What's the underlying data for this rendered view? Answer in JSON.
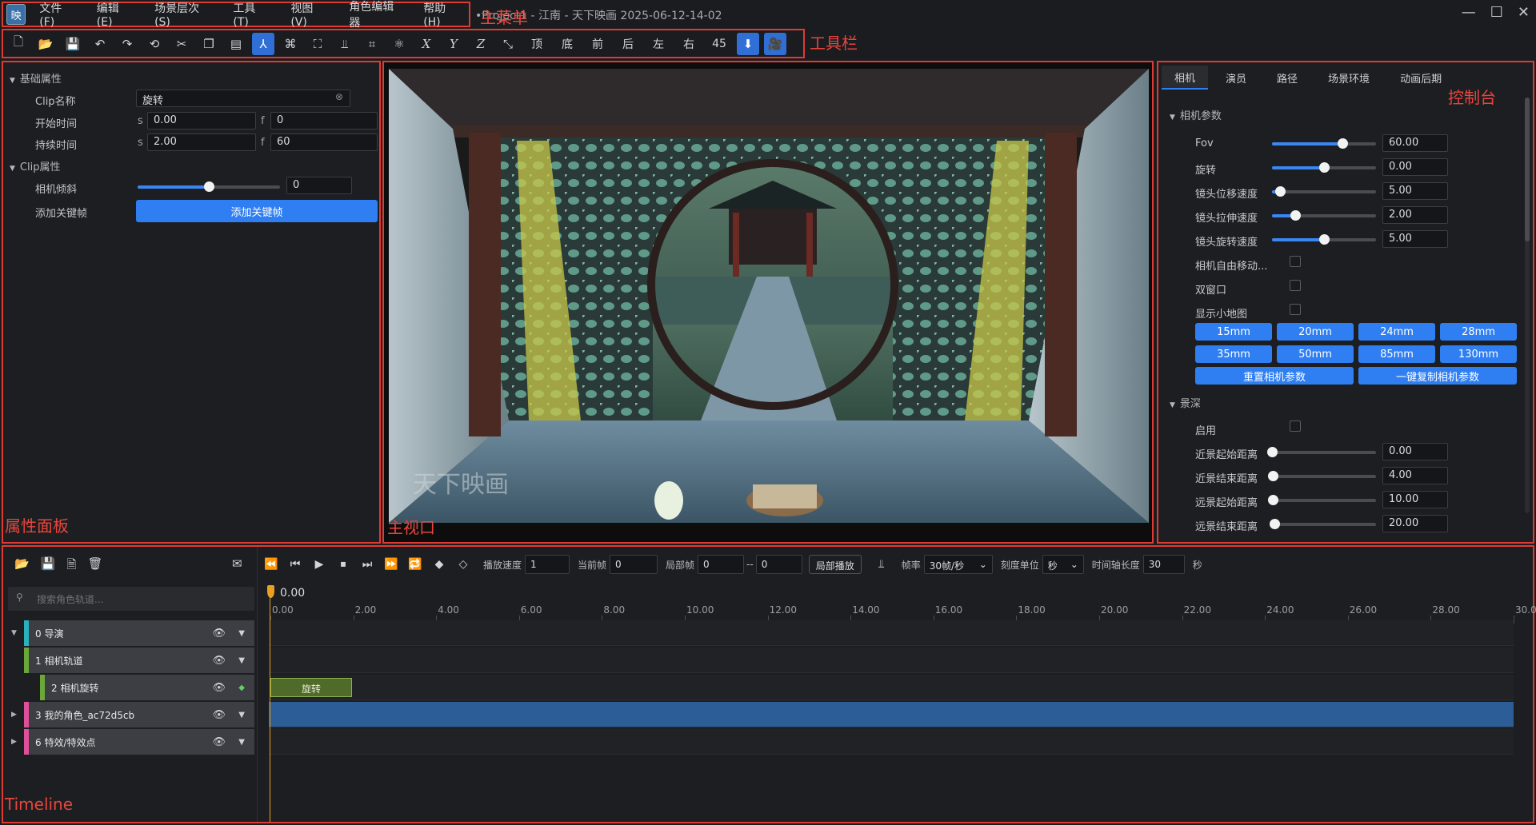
{
  "app": {
    "logo_glyph": "映",
    "title": "•Project1 - 江南 - 天下映画 2025-06-12-14-02"
  },
  "annotations": {
    "menu": "主菜单",
    "toolbar": "工具栏",
    "properties": "属性面板",
    "viewport": "主视口",
    "console": "控制台",
    "timeline": "Timeline"
  },
  "menu": [
    "文件(F)",
    "编辑(E)",
    "场景层次(S)",
    "工具(T)",
    "视图(V)",
    "角色编辑器",
    "帮助(H)"
  ],
  "window_controls": {
    "minimize": "—",
    "maximize": "☐",
    "close": "✕"
  },
  "toolbar": {
    "icons": [
      {
        "name": "new-file-icon",
        "glyph": "🗋"
      },
      {
        "name": "open-folder-icon",
        "glyph": "📂"
      },
      {
        "name": "save-icon",
        "glyph": "💾"
      },
      {
        "name": "undo-icon",
        "glyph": "↶"
      },
      {
        "name": "redo-icon",
        "glyph": "↷"
      },
      {
        "name": "history-icon",
        "glyph": "⟲"
      },
      {
        "name": "cut-icon",
        "glyph": "✂"
      },
      {
        "name": "copy-icon",
        "glyph": "❐"
      },
      {
        "name": "paste-icon",
        "glyph": "▤"
      },
      {
        "name": "transform-gizmo-icon",
        "glyph": "⅄"
      },
      {
        "name": "group-icon",
        "glyph": "⌘"
      },
      {
        "name": "fullscreen-icon",
        "glyph": "⛶"
      },
      {
        "name": "align-icon",
        "glyph": "⫫"
      },
      {
        "name": "crop-icon",
        "glyph": "⌗"
      },
      {
        "name": "nodes-icon",
        "glyph": "⚛"
      }
    ],
    "axes": [
      "X",
      "Y",
      "Z"
    ],
    "axis_icon": "⤡",
    "views": [
      "顶",
      "底",
      "前",
      "后",
      "左",
      "右",
      "45"
    ],
    "camera_icons": [
      {
        "name": "download-icon",
        "glyph": "⬇"
      },
      {
        "name": "camera-icon",
        "glyph": "🎥"
      }
    ]
  },
  "properties": {
    "basic_section": "基础属性",
    "clip_name_label": "Clip名称",
    "clip_name_value": "旋转",
    "clip_name_clear": "⊗",
    "start_label": "开始时间",
    "start_s_unit": "s",
    "start_s": "0.00",
    "start_f_unit": "f",
    "start_f": "0",
    "duration_label": "持续时间",
    "duration_s_unit": "s",
    "duration_s": "2.00",
    "duration_f_unit": "f",
    "duration_f": "60",
    "clip_section": "Clip属性",
    "tilt_label": "相机倾斜",
    "tilt_value": "0",
    "tilt_fraction": 0.5,
    "keyframe_label": "添加关键帧",
    "keyframe_button": "添加关键帧"
  },
  "viewport": {
    "watermark": "天下映画"
  },
  "console": {
    "tabs": [
      "相机",
      "演员",
      "路径",
      "场景环境",
      "动画后期"
    ],
    "camera_section": "相机参数",
    "sliders": [
      {
        "label": "Fov",
        "value": "60.00",
        "fraction": 0.68
      },
      {
        "label": "旋转",
        "value": "0.00",
        "fraction": 0.5
      },
      {
        "label": "镜头位移速度",
        "value": "5.00",
        "fraction": 0.08
      },
      {
        "label": "镜头拉伸速度",
        "value": "2.00",
        "fraction": 0.22
      },
      {
        "label": "镜头旋转速度",
        "value": "5.00",
        "fraction": 0.5
      }
    ],
    "checks": [
      "相机自由移动...",
      "双窗口",
      "显示小地图"
    ],
    "lenses": [
      "15mm",
      "20mm",
      "24mm",
      "28mm",
      "35mm",
      "50mm",
      "85mm",
      "130mm"
    ],
    "reset_button": "重置相机参数",
    "copy_button": "一键复制相机参数",
    "dof_section": "景深",
    "dof_enable": "启用",
    "dof_sliders": [
      {
        "label": "近景起始距离",
        "value": "0.00",
        "fraction": 0.0
      },
      {
        "label": "近景结束距离",
        "value": "4.00",
        "fraction": 0.01
      },
      {
        "label": "远景起始距离",
        "value": "10.00",
        "fraction": 0.01
      },
      {
        "label": "远景结束距离",
        "value": "20.00",
        "fraction": 0.02
      }
    ]
  },
  "timeline": {
    "search_placeholder": "搜索角色轨道...",
    "tracks": [
      {
        "label": "0 导演",
        "color": "#2bb1bd"
      },
      {
        "label": "1 相机轨道",
        "color": "#6aa83a"
      },
      {
        "label": "2 相机旋转",
        "color": "#6aa83a"
      },
      {
        "label": "3 我的角色_ac72d5cb",
        "color": "#e04f9a"
      },
      {
        "label": "6 特效/特效点",
        "color": "#e04f9a"
      }
    ],
    "controls": {
      "speed_label": "播放速度",
      "speed_value": "1",
      "current_label": "当前帧",
      "current_value": "0",
      "local_label": "局部帧",
      "local_from": "0",
      "local_sep": "--",
      "local_to": "0",
      "local_play": "局部播放",
      "fps_label": "帧率",
      "fps_value": "30帧/秒",
      "unit_label": "刻度单位",
      "unit_value": "秒",
      "length_label": "时间轴长度",
      "length_value": "30",
      "length_unit": "秒"
    },
    "playhead": "0.00",
    "ruler": [
      "0.00",
      "2.00",
      "4.00",
      "6.00",
      "8.00",
      "10.00",
      "12.00",
      "14.00",
      "16.00",
      "18.00",
      "20.00",
      "22.00",
      "24.00",
      "26.00",
      "28.00",
      "30.0"
    ],
    "clip_label": "旋转"
  }
}
